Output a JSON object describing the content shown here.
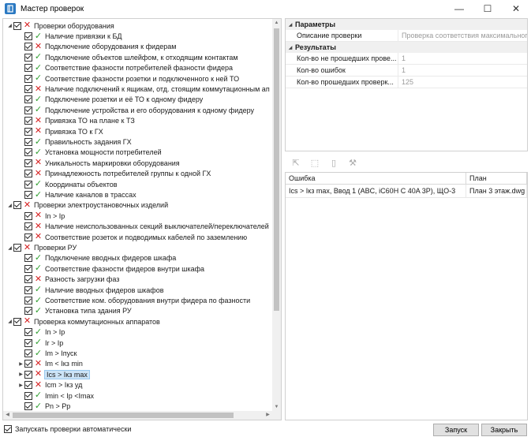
{
  "window": {
    "title": "Мастер проверок",
    "app_icon": "app-logo-icon",
    "minimize_glyph": "—",
    "maximize_glyph": "☐",
    "close_glyph": "✕"
  },
  "tree": {
    "rows": [
      {
        "label": "Проверки оборудования",
        "status": "fail",
        "level": 0,
        "expander": "◢"
      },
      {
        "label": "Наличие привязки к БД",
        "status": "ok",
        "level": 1,
        "expander": ""
      },
      {
        "label": "Подключение оборудования к фидерам",
        "status": "fail",
        "level": 1,
        "expander": ""
      },
      {
        "label": "Подключение объектов шлейфом, к отходящим контактам",
        "status": "ok",
        "level": 1,
        "expander": ""
      },
      {
        "label": "Соответствие фазности потребителей фазности фидера",
        "status": "ok",
        "level": 1,
        "expander": ""
      },
      {
        "label": "Соответствие фазности розетки и подключенного к ней ТО",
        "status": "ok",
        "level": 1,
        "expander": ""
      },
      {
        "label": "Наличие подключений к ящикам, отд. стоящим коммутационным ап",
        "status": "fail",
        "level": 1,
        "expander": ""
      },
      {
        "label": "Подключение розетки и её ТО к одному фидеру",
        "status": "ok",
        "level": 1,
        "expander": ""
      },
      {
        "label": "Подключение устройства и его оборудования к одному фидеру",
        "status": "ok",
        "level": 1,
        "expander": ""
      },
      {
        "label": "Привязка ТО на плане к ТЗ",
        "status": "fail",
        "level": 1,
        "expander": ""
      },
      {
        "label": "Привязка ТО к ГХ",
        "status": "fail",
        "level": 1,
        "expander": ""
      },
      {
        "label": "Правильность задания ГХ",
        "status": "ok",
        "level": 1,
        "expander": ""
      },
      {
        "label": "Установка мощности потребителей",
        "status": "ok",
        "level": 1,
        "expander": ""
      },
      {
        "label": "Уникальность маркировки оборудования",
        "status": "fail",
        "level": 1,
        "expander": ""
      },
      {
        "label": "Принадлежность потребителей группы к одной ГХ",
        "status": "fail",
        "level": 1,
        "expander": ""
      },
      {
        "label": "Координаты объектов",
        "status": "ok",
        "level": 1,
        "expander": ""
      },
      {
        "label": "Наличие каналов в трассах",
        "status": "ok",
        "level": 1,
        "expander": ""
      },
      {
        "label": "Проверки электроустановочных изделий",
        "status": "fail",
        "level": 0,
        "expander": "◢"
      },
      {
        "label": "In > Ip",
        "status": "fail",
        "level": 1,
        "expander": ""
      },
      {
        "label": "Наличие неиспользованных секций выключателей/переключателей",
        "status": "fail",
        "level": 1,
        "expander": ""
      },
      {
        "label": "Соответствие розеток и подводимых кабелей по заземлению",
        "status": "fail",
        "level": 1,
        "expander": ""
      },
      {
        "label": "Проверки РУ",
        "status": "fail",
        "level": 0,
        "expander": "◢"
      },
      {
        "label": "Подключение вводных фидеров шкафа",
        "status": "ok",
        "level": 1,
        "expander": ""
      },
      {
        "label": "Соответствие фазности фидеров внутри шкафа",
        "status": "ok",
        "level": 1,
        "expander": ""
      },
      {
        "label": "Разность загрузки фаз",
        "status": "fail",
        "level": 1,
        "expander": ""
      },
      {
        "label": "Наличие вводных фидеров шкафов",
        "status": "ok",
        "level": 1,
        "expander": ""
      },
      {
        "label": "Соответствие ком. оборудования внутри фидера по фазности",
        "status": "ok",
        "level": 1,
        "expander": ""
      },
      {
        "label": "Установка типа здания РУ",
        "status": "ok",
        "level": 1,
        "expander": ""
      },
      {
        "label": "Проверка коммутационных аппаратов",
        "status": "fail",
        "level": 0,
        "expander": "◢"
      },
      {
        "label": "In > Ip",
        "status": "ok",
        "level": 1,
        "expander": ""
      },
      {
        "label": "Ir > Ip",
        "status": "ok",
        "level": 1,
        "expander": ""
      },
      {
        "label": "Im > Iпуск",
        "status": "ok",
        "level": 1,
        "expander": ""
      },
      {
        "label": "Im < Iкз min",
        "status": "fail",
        "level": 1,
        "expander": "▶"
      },
      {
        "label": "Ics > Iкз max",
        "status": "fail",
        "level": 1,
        "expander": "▶",
        "selected": true
      },
      {
        "label": "Icm > Iкз уд",
        "status": "fail",
        "level": 1,
        "expander": "▶"
      },
      {
        "label": "Imin < Ip <Imax",
        "status": "ok",
        "level": 1,
        "expander": ""
      },
      {
        "label": "Pn > Pp",
        "status": "ok",
        "level": 1,
        "expander": ""
      }
    ]
  },
  "properties": {
    "categories": [
      {
        "label": "Параметры",
        "rows": [
          {
            "name": "Описание проверки",
            "value": "Проверка соответствия максимального"
          }
        ]
      },
      {
        "label": "Результаты",
        "rows": [
          {
            "name": "Кол-во не прошедших прове...",
            "value": "1"
          },
          {
            "name": "Кол-во ошибок",
            "value": "1"
          },
          {
            "name": "Кол-во прошедших проверк...",
            "value": "125"
          }
        ]
      }
    ]
  },
  "toolbar": {
    "icons": [
      "export-icon",
      "zoom-to-icon",
      "document-icon",
      "tools-icon"
    ],
    "glyphs": [
      "⇱",
      "⬚",
      "▯",
      "⚒"
    ]
  },
  "errors": {
    "headers": {
      "error": "Ошибка",
      "plan": "План"
    },
    "rows": [
      {
        "error": "Ics > Iкз max, Ввод 1 (ABC, iC60H C 40A 3P), ЩО-3",
        "plan": "План 3 этаж.dwg"
      }
    ]
  },
  "footer": {
    "auto_run_label": "Запускать проверки автоматически",
    "auto_run_checked": true,
    "run_button": "Запуск",
    "close_button": "Закрыть"
  },
  "colors": {
    "ok": "#2e9d2e",
    "fail": "#d52020",
    "selection": "#cce4f7",
    "accent": "#2b79c2"
  }
}
